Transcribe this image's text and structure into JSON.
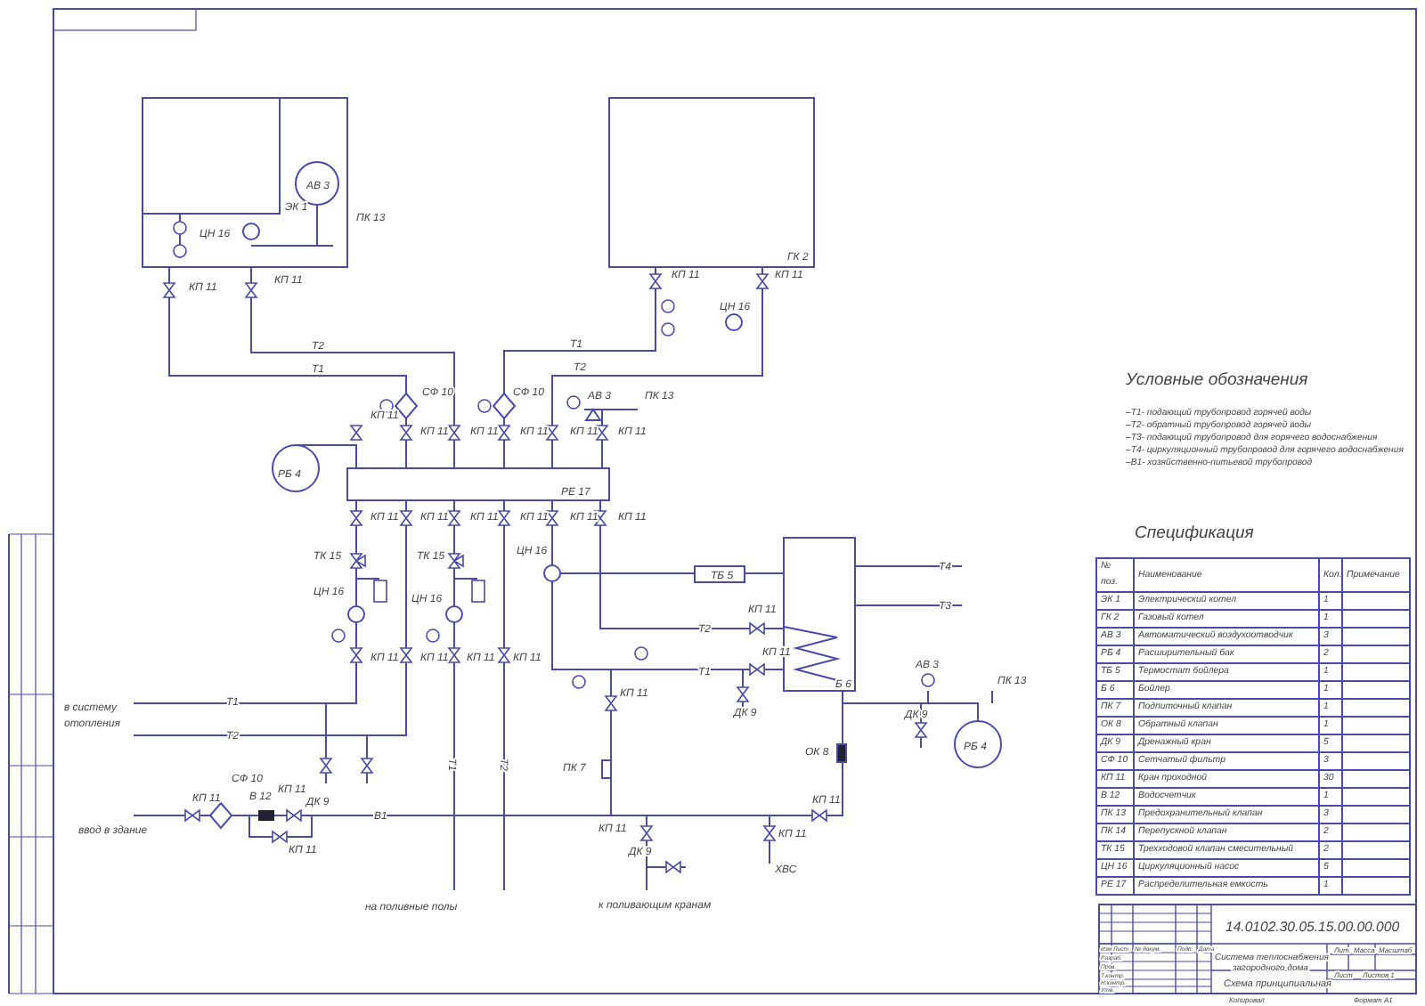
{
  "drawing": {
    "labels": [
      "ЭК 1",
      "АВ 3",
      "ЦН 16",
      "ПК 13",
      "КП 11",
      "КП 11",
      "ГК 2",
      "КП 11",
      "КП 11",
      "ЦН 16",
      "Т2",
      "Т1",
      "Т1",
      "Т2",
      "СФ 10",
      "СФ 10",
      "АВ 3",
      "ПК 13",
      "КП 11",
      "КП 11",
      "КП 11",
      "КП 11",
      "КП 11",
      "КП 11",
      "РБ 4",
      "РЕ 17",
      "КП 11",
      "КП 11",
      "КП 11",
      "КП 11",
      "КП 11",
      "КП 11",
      "ТК 15",
      "ТК 15",
      "ЦН 16",
      "ЦН 16",
      "ЦН 16",
      "ТБ 5",
      "КП 11",
      "Т2",
      "КП 11",
      "Т1",
      "КП 11",
      "КП 11",
      "КП 11",
      "КП 11",
      "КП 11",
      "ДК 9",
      "в систему",
      "отопления",
      "Т1",
      "Т2",
      "Т1",
      "Т2",
      "ПК 7",
      "ОК 8",
      "СФ 10",
      "В 12",
      "КП 11",
      "КП 11",
      "ДК 9",
      "В1",
      "ввод в здание",
      "КП 11",
      "КП 11",
      "ДК 9",
      "КП 11",
      "КП 11",
      "ХВС",
      "на поливные полы",
      "к поливающим кранам",
      "Т4",
      "Т3",
      "Б 6",
      "АВ 3",
      "ПК 13",
      "ДК 9",
      "РБ 4"
    ]
  },
  "legend": {
    "title": "Условные обозначения",
    "items": [
      "–Т1- подающий трубопровод горячей воды",
      "–Т2- обратный трубопровод горячей воды",
      "–Т3- подающий трубопровод для горячего водоснабжения",
      "–Т4- циркуляционный трубопровод для горячего водоснабжения",
      "–В1- хозяйственно-питьевой трубопровод"
    ]
  },
  "specification": {
    "title": "Спецификация",
    "columns": [
      "№ поз.",
      "Наименование",
      "Кол.",
      "Примечание"
    ],
    "rows": [
      {
        "pos": "ЭК 1",
        "name": "Электрический котел",
        "qty": "1"
      },
      {
        "pos": "ГК 2",
        "name": "Газовый котел",
        "qty": "1"
      },
      {
        "pos": "АВ 3",
        "name": "Автоматический воздухоотводчик",
        "qty": "3"
      },
      {
        "pos": "РБ 4",
        "name": "Расширительный бак",
        "qty": "2"
      },
      {
        "pos": "ТБ 5",
        "name": "Термостат бойлера",
        "qty": "1"
      },
      {
        "pos": "Б 6",
        "name": "Бойлер",
        "qty": "1"
      },
      {
        "pos": "ПК 7",
        "name": "Подпиточный клапан",
        "qty": "1"
      },
      {
        "pos": "ОК 8",
        "name": "Обратный клапан",
        "qty": "1"
      },
      {
        "pos": "ДК 9",
        "name": "Дренажный кран",
        "qty": "5"
      },
      {
        "pos": "СФ 10",
        "name": "Сетчатый фильтр",
        "qty": "3"
      },
      {
        "pos": "КП 11",
        "name": "Кран проходной",
        "qty": "30"
      },
      {
        "pos": "В 12",
        "name": "Водосчетчик",
        "qty": "1"
      },
      {
        "pos": "ПК 13",
        "name": "Предохранительный клапан",
        "qty": "3"
      },
      {
        "pos": "ПК 14",
        "name": "Перепускной клапан",
        "qty": "2"
      },
      {
        "pos": "ТК 15",
        "name": "Трехходовой клапан смесительный",
        "qty": "2"
      },
      {
        "pos": "ЦН 16",
        "name": "Циркуляционный насос",
        "qty": "5"
      },
      {
        "pos": "РЕ 17",
        "name": "Распределительная емкость",
        "qty": "1"
      }
    ]
  },
  "title_block": {
    "code": "14.0102.30.05.15.00.00.000",
    "title": "Система теплоснабжения загородного дома",
    "subtitle": "Схема принципиальная",
    "header_cells": [
      "Изм.",
      "Лист",
      "№ докум.",
      "Подп.",
      "Дата"
    ],
    "roles": [
      "Разраб.",
      "Пров.",
      "Т.контр.",
      "Н.контр.",
      "Утв."
    ],
    "right_header": [
      "Лит.",
      "Масса",
      "Масштаб"
    ],
    "sheet_label": "Лист",
    "sheets_label": "Листов 1",
    "copied": "Копировал",
    "format": "Формат А1"
  }
}
